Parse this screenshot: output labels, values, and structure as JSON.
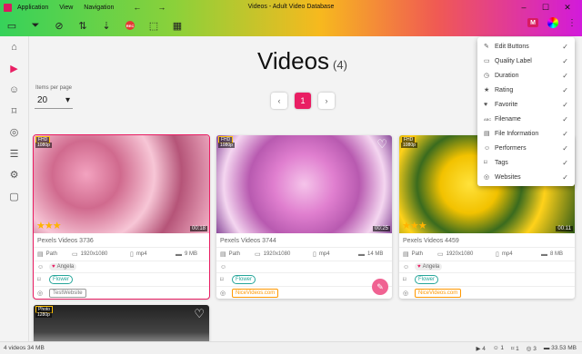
{
  "window": {
    "title": "Videos - Adult Video Database",
    "menu": [
      "Application",
      "View",
      "Navigation"
    ],
    "nav_back": "←",
    "nav_forward": "→",
    "min": "–",
    "max": "☐",
    "close": "✕"
  },
  "toolbar": {
    "rec_label": "REC",
    "m_badge": "M"
  },
  "page": {
    "title": "Videos",
    "count": "(4)",
    "items_per_page_label": "Items per page",
    "items_per_page_value": "20",
    "current_page": "1"
  },
  "cards": [
    {
      "name": "Pexels Videos 3736",
      "quality": "FHD",
      "resolution_badge": "1080p",
      "duration": "00:18",
      "stars": "★★★",
      "path_label": "Path",
      "resolution": "1920x1080",
      "format": "mp4",
      "size": "9 MB",
      "performer": "Angela",
      "tag": "Flower",
      "website": "TestWebsite"
    },
    {
      "name": "Pexels Videos 3744",
      "quality": "FHD",
      "resolution_badge": "1080p",
      "duration": "00:25",
      "stars": "",
      "path_label": "Path",
      "resolution": "1920x1080",
      "format": "mp4",
      "size": "14 MB",
      "performer": "",
      "tag": "Flower",
      "website": "NiceVideos.com"
    },
    {
      "name": "Pexels Videos 4459",
      "quality": "FHD",
      "resolution_badge": "1080p",
      "duration": "00:11",
      "stars": "★★★",
      "path_label": "Path",
      "resolution": "1920x1080",
      "format": "mp4",
      "size": "8 MB",
      "performer": "Angela",
      "tag": "Flower",
      "website": "NiceVideos.com"
    },
    {
      "quality": "Photo",
      "resolution_badge": "1280p"
    }
  ],
  "dropdown": {
    "items": [
      {
        "icon": "pencil-icon",
        "label": "Edit Buttons"
      },
      {
        "icon": "hd-icon",
        "label": "Quality Label"
      },
      {
        "icon": "clock-icon",
        "label": "Duration"
      },
      {
        "icon": "star-icon",
        "label": "Rating"
      },
      {
        "icon": "heart-icon",
        "label": "Favorite"
      },
      {
        "icon": "abc-icon",
        "label": "Filename"
      },
      {
        "icon": "info-icon",
        "label": "File Information"
      },
      {
        "icon": "person-icon",
        "label": "Performers"
      },
      {
        "icon": "tag-icon",
        "label": "Tags"
      },
      {
        "icon": "globe-icon",
        "label": "Websites"
      }
    ]
  },
  "status": {
    "left": "4 videos 34 MB",
    "videos": "4",
    "performers": "1",
    "tags": "1",
    "websites": "3",
    "size": "33.53 MB"
  },
  "colors": {
    "accent": "#e91e63"
  }
}
